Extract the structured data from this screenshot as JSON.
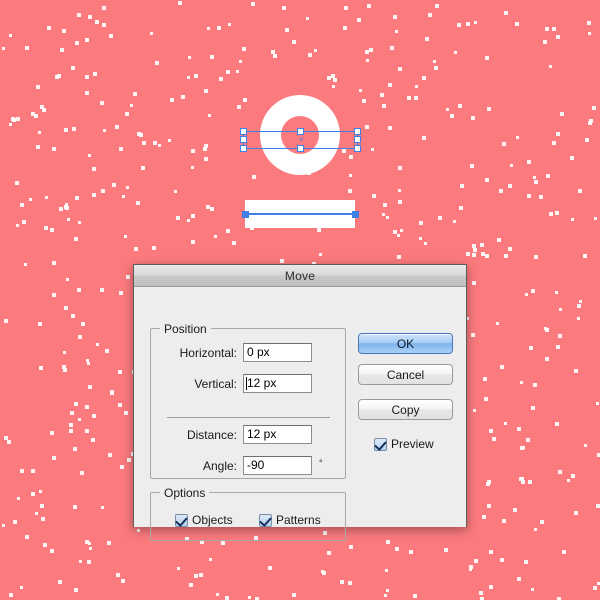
{
  "app": {
    "canvas_background_color": "#fa7a7d",
    "artwork_fill_color": "#ffffff",
    "selection_color": "#3f7fe8"
  },
  "artwork": {
    "ellipse_name": "white-ellipse",
    "inner_ellipse_name": "coral-inner-ellipse",
    "rectangle_name": "white-rectangle",
    "center_marker": "×"
  },
  "dialog": {
    "title": "Move",
    "position_group": {
      "legend": "Position",
      "fields": [
        {
          "label": "Horizontal:",
          "value": "0 px",
          "unit": "",
          "focused": false
        },
        {
          "label": "Vertical:",
          "value": "12 px",
          "unit": "",
          "focused": true
        },
        {
          "label": "Distance:",
          "value": "12 px",
          "unit": "",
          "focused": false
        },
        {
          "label": "Angle:",
          "value": "-90",
          "unit": "°",
          "focused": false
        }
      ]
    },
    "options_group": {
      "legend": "Options",
      "checkboxes": [
        {
          "label": "Objects",
          "checked": true
        },
        {
          "label": "Patterns",
          "checked": true
        }
      ]
    },
    "buttons": [
      {
        "label": "OK",
        "primary": true
      },
      {
        "label": "Cancel",
        "primary": false
      },
      {
        "label": "Copy",
        "primary": false
      }
    ],
    "preview": {
      "label": "Preview",
      "checked": true
    }
  }
}
